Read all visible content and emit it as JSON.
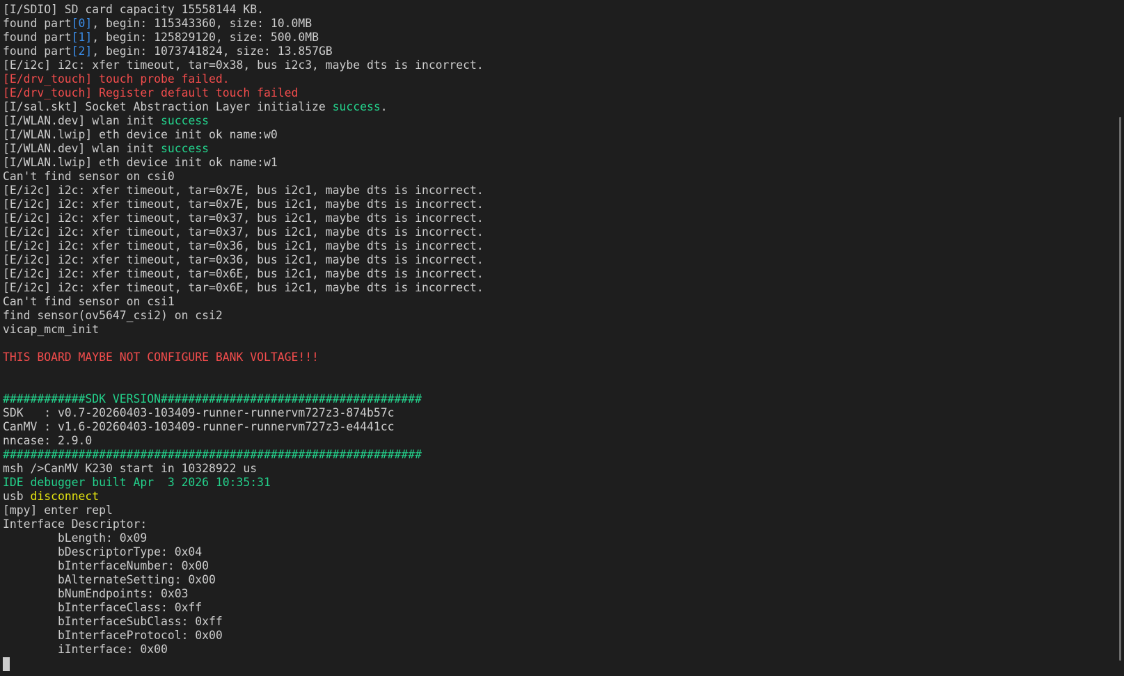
{
  "colors": {
    "background": "#1e1e1e",
    "default": "#cccccc",
    "red": "#f14c4c",
    "green": "#23d18b",
    "blue": "#3b8eea",
    "yellow": "#e5e510"
  },
  "lines": [
    [
      {
        "t": "[I/SDIO] SD card capacity 15558144 KB.",
        "c": "default"
      }
    ],
    [
      {
        "t": "found part",
        "c": "default"
      },
      {
        "t": "[0]",
        "c": "blue"
      },
      {
        "t": ", begin: 115343360, size: 10.0MB",
        "c": "default"
      }
    ],
    [
      {
        "t": "found part",
        "c": "default"
      },
      {
        "t": "[1]",
        "c": "blue"
      },
      {
        "t": ", begin: 125829120, size: 500.0MB",
        "c": "default"
      }
    ],
    [
      {
        "t": "found part",
        "c": "default"
      },
      {
        "t": "[2]",
        "c": "blue"
      },
      {
        "t": ", begin: 1073741824, size: 13.857GB",
        "c": "default"
      }
    ],
    [
      {
        "t": "[E/i2c] i2c: xfer timeout, tar=0x38, bus i2c3, maybe dts is incorrect.",
        "c": "default"
      }
    ],
    [
      {
        "t": "[E/drv_touch] touch probe failed.",
        "c": "red"
      }
    ],
    [
      {
        "t": "[E/drv_touch] Register default touch failed",
        "c": "red"
      }
    ],
    [
      {
        "t": "[I/sal.skt] Socket Abstraction Layer initialize ",
        "c": "default"
      },
      {
        "t": "success",
        "c": "green"
      },
      {
        "t": ".",
        "c": "default"
      }
    ],
    [
      {
        "t": "[I/WLAN.dev] wlan init ",
        "c": "default"
      },
      {
        "t": "success",
        "c": "green"
      }
    ],
    [
      {
        "t": "[I/WLAN.lwip] eth device init ok name:w0",
        "c": "default"
      }
    ],
    [
      {
        "t": "[I/WLAN.dev] wlan init ",
        "c": "default"
      },
      {
        "t": "success",
        "c": "green"
      }
    ],
    [
      {
        "t": "[I/WLAN.lwip] eth device init ok name:w1",
        "c": "default"
      }
    ],
    [
      {
        "t": "Can't find sensor on csi0",
        "c": "default"
      }
    ],
    [
      {
        "t": "[E/i2c] i2c: xfer timeout, tar=0x7E, bus i2c1, maybe dts is incorrect.",
        "c": "default"
      }
    ],
    [
      {
        "t": "[E/i2c] i2c: xfer timeout, tar=0x7E, bus i2c1, maybe dts is incorrect.",
        "c": "default"
      }
    ],
    [
      {
        "t": "[E/i2c] i2c: xfer timeout, tar=0x37, bus i2c1, maybe dts is incorrect.",
        "c": "default"
      }
    ],
    [
      {
        "t": "[E/i2c] i2c: xfer timeout, tar=0x37, bus i2c1, maybe dts is incorrect.",
        "c": "default"
      }
    ],
    [
      {
        "t": "[E/i2c] i2c: xfer timeout, tar=0x36, bus i2c1, maybe dts is incorrect.",
        "c": "default"
      }
    ],
    [
      {
        "t": "[E/i2c] i2c: xfer timeout, tar=0x36, bus i2c1, maybe dts is incorrect.",
        "c": "default"
      }
    ],
    [
      {
        "t": "[E/i2c] i2c: xfer timeout, tar=0x6E, bus i2c1, maybe dts is incorrect.",
        "c": "default"
      }
    ],
    [
      {
        "t": "[E/i2c] i2c: xfer timeout, tar=0x6E, bus i2c1, maybe dts is incorrect.",
        "c": "default"
      }
    ],
    [
      {
        "t": "Can't find sensor on csi1",
        "c": "default"
      }
    ],
    [
      {
        "t": "find sensor(ov5647_csi2) on csi2",
        "c": "default"
      }
    ],
    [
      {
        "t": "vicap_mcm_init",
        "c": "default"
      }
    ],
    [],
    [
      {
        "t": "THIS BOARD MAYBE NOT CONFIGURE BANK VOLTAGE!!!",
        "c": "red"
      }
    ],
    [],
    [],
    [
      {
        "t": "############SDK VERSION######################################",
        "c": "green"
      }
    ],
    [
      {
        "t": "SDK   : v0.7-20260403-103409-runner-runnervm727z3-874b57c",
        "c": "default"
      }
    ],
    [
      {
        "t": "CanMV : v1.6-20260403-103409-runner-runnervm727z3-e4441cc",
        "c": "default"
      }
    ],
    [
      {
        "t": "nncase: 2.9.0",
        "c": "default"
      }
    ],
    [
      {
        "t": "#############################################################",
        "c": "green"
      }
    ],
    [
      {
        "t": "msh />CanMV K230 start in 10328922 us",
        "c": "default"
      }
    ],
    [
      {
        "t": "IDE debugger built Apr  3 2026 10:35:31",
        "c": "green"
      }
    ],
    [
      {
        "t": "usb ",
        "c": "default"
      },
      {
        "t": "disconnect",
        "c": "yellow"
      }
    ],
    [
      {
        "t": "[mpy] enter repl",
        "c": "default"
      }
    ],
    [
      {
        "t": "Interface Descriptor:",
        "c": "default"
      }
    ],
    [
      {
        "t": "        bLength: 0x09",
        "c": "default"
      }
    ],
    [
      {
        "t": "        bDescriptorType: 0x04",
        "c": "default"
      }
    ],
    [
      {
        "t": "        bInterfaceNumber: 0x00",
        "c": "default"
      }
    ],
    [
      {
        "t": "        bAlternateSetting: 0x00",
        "c": "default"
      }
    ],
    [
      {
        "t": "        bNumEndpoints: 0x03",
        "c": "default"
      }
    ],
    [
      {
        "t": "        bInterfaceClass: 0xff",
        "c": "default"
      }
    ],
    [
      {
        "t": "        bInterfaceSubClass: 0xff",
        "c": "default"
      }
    ],
    [
      {
        "t": "        bInterfaceProtocol: 0x00",
        "c": "default"
      }
    ],
    [
      {
        "t": "        iInterface: 0x00",
        "c": "default"
      }
    ]
  ]
}
